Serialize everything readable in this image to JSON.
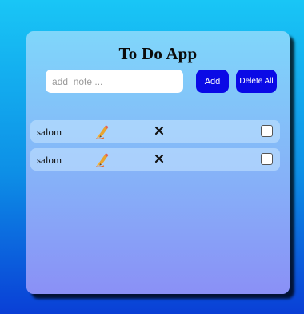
{
  "app": {
    "title": "To Do App"
  },
  "form": {
    "input_placeholder": "add  note ...",
    "input_value": "",
    "add_label": "Add",
    "delete_all_label": "Delete All"
  },
  "todos": [
    {
      "text": "salom",
      "checked": false
    },
    {
      "text": "salom",
      "checked": false
    }
  ],
  "icons": {
    "edit": "pencil-writing-icon",
    "remove": "close-x-icon"
  },
  "colors": {
    "button": "#0a0ae6",
    "text": "#111111"
  }
}
